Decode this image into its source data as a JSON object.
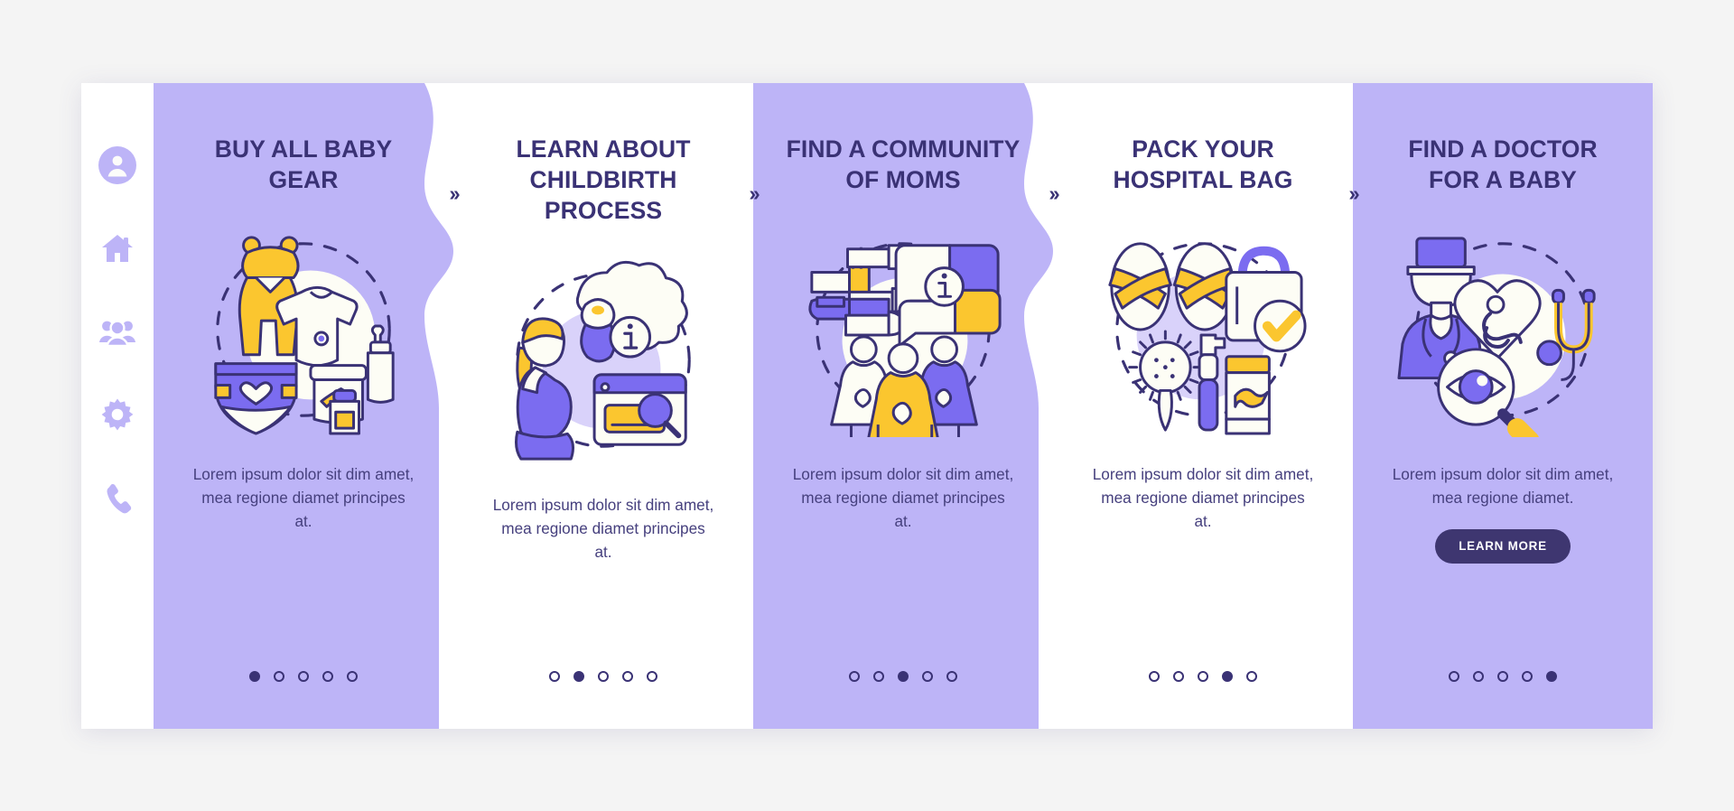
{
  "theme": {
    "page_bg": "#f4f4f4",
    "card_purple": "#bdb4f7",
    "card_white": "#ffffff",
    "title_navy": "#3a3275",
    "body_navy": "#46407e",
    "accent_yellow": "#fbc62f",
    "accent_violet": "#7b6cf0",
    "button_navy": "#3e3670",
    "sidebar_icon": "#bdb4f7"
  },
  "sidebar": {
    "items": [
      {
        "icon": "user-circle-icon",
        "name": "sidebar-item-profile"
      },
      {
        "icon": "home-icon",
        "name": "sidebar-item-home"
      },
      {
        "icon": "people-group-icon",
        "name": "sidebar-item-community"
      },
      {
        "icon": "gear-icon",
        "name": "sidebar-item-settings"
      },
      {
        "icon": "phone-icon",
        "name": "sidebar-item-contact"
      }
    ]
  },
  "separator": {
    "glyph": "››",
    "label": "next-step-chevron"
  },
  "cards": [
    {
      "title": "BUY ALL BABY GEAR",
      "body": "Lorem ipsum dolor sit dim amet, mea regione diamet principes at.",
      "illustration": "baby-gear-illustration",
      "variant": "purple",
      "dots": {
        "count": 5,
        "active": 0
      },
      "button": null
    },
    {
      "title": "LEARN ABOUT CHILDBIRTH PROCESS",
      "body": "Lorem ipsum dolor sit dim amet, mea regione diamet principes at.",
      "illustration": "pregnant-woman-info-illustration",
      "variant": "white",
      "dots": {
        "count": 5,
        "active": 1
      },
      "button": null
    },
    {
      "title": "FIND A COMMUNITY OF MOMS",
      "body": "Lorem ipsum dolor sit dim amet, mea regione diamet principes at.",
      "illustration": "community-of-moms-illustration",
      "variant": "purple",
      "dots": {
        "count": 5,
        "active": 2
      },
      "button": null
    },
    {
      "title": "PACK YOUR HOSPITAL BAG",
      "body": "Lorem ipsum dolor sit dim amet, mea regione diamet principes at.",
      "illustration": "hospital-bag-illustration",
      "variant": "white",
      "dots": {
        "count": 5,
        "active": 3
      },
      "button": null
    },
    {
      "title": "FIND A DOCTOR FOR A BABY",
      "body": "Lorem ipsum dolor sit dim amet, mea regione diamet.",
      "illustration": "doctor-checkup-illustration",
      "variant": "purple",
      "dots": {
        "count": 5,
        "active": 4
      },
      "button": "LEARN MORE"
    }
  ]
}
